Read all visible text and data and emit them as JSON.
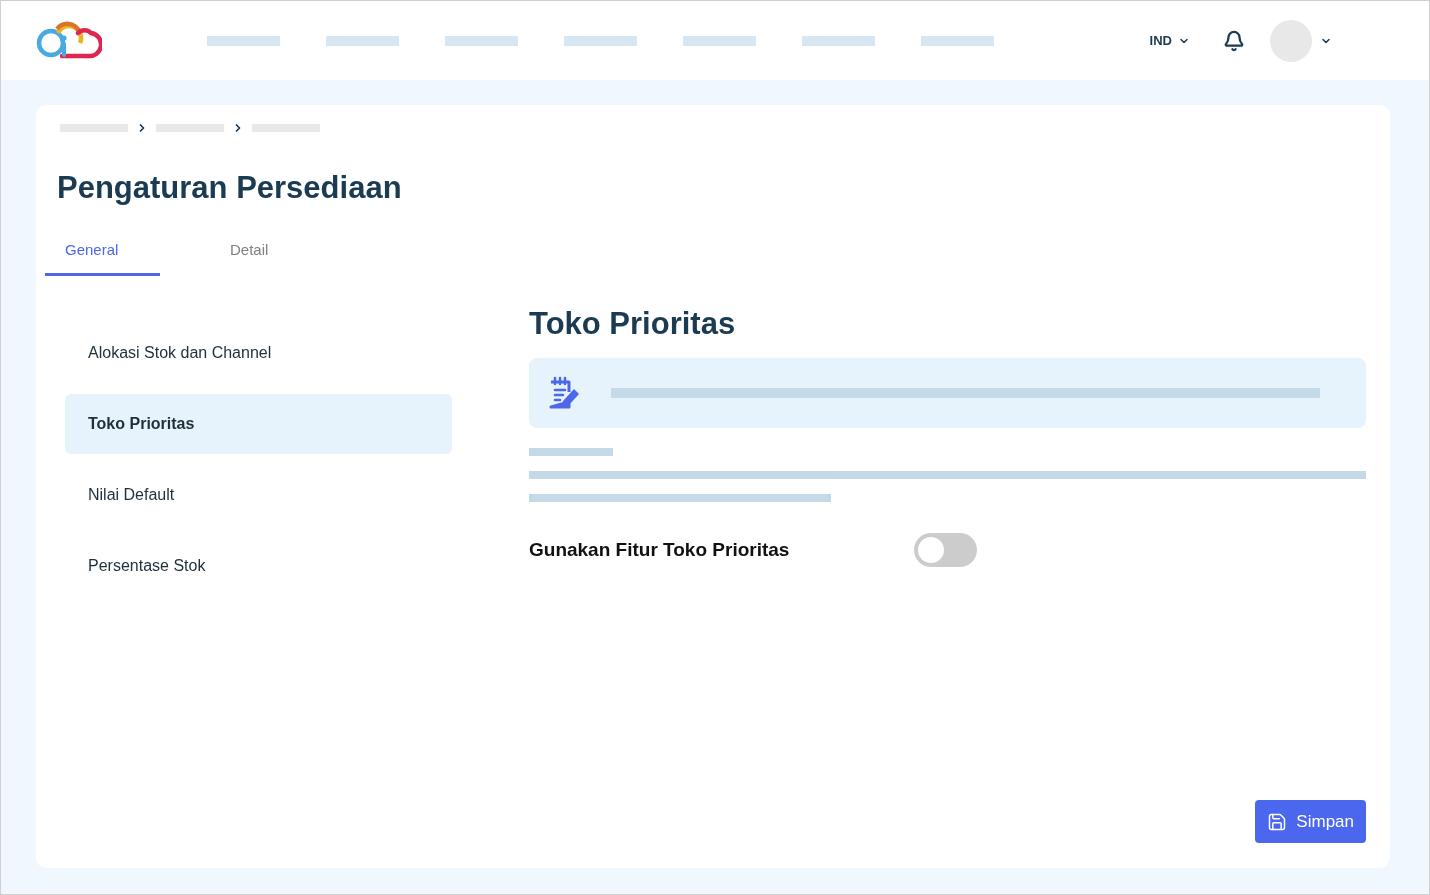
{
  "header": {
    "language": "IND"
  },
  "page_title": "Pengaturan Persediaan",
  "tabs": [
    {
      "label": "General",
      "selected": true
    },
    {
      "label": "Detail",
      "selected": false
    }
  ],
  "sidebar": {
    "items": [
      {
        "label": "Alokasi Stok dan Channel",
        "selected": false
      },
      {
        "label": "Toko Prioritas",
        "selected": true
      },
      {
        "label": "Nilai Default",
        "selected": false
      },
      {
        "label": "Persentase Stok",
        "selected": false
      }
    ]
  },
  "section": {
    "title": "Toko Prioritas",
    "setting": {
      "label": "Gunakan Fitur Toko Prioritas",
      "on": false
    }
  },
  "save_button": {
    "label": "Simpan"
  }
}
